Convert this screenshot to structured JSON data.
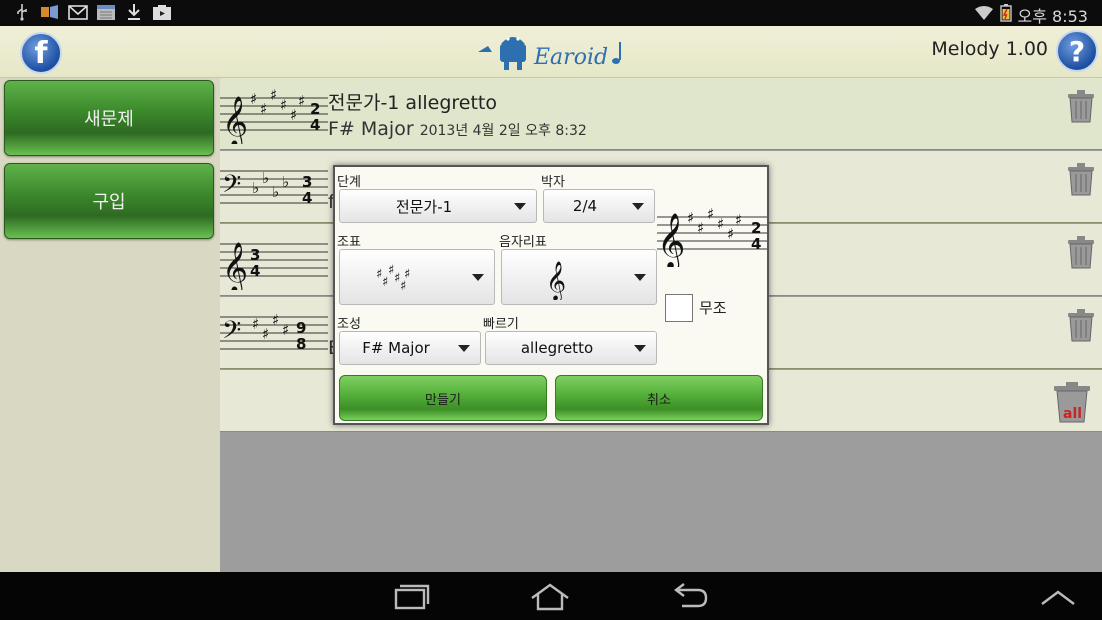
{
  "status_bar": {
    "left_icons": [
      "usb-icon",
      "media-icon",
      "gmail-icon",
      "calendar-icon",
      "download-icon",
      "video-icon"
    ],
    "right_icons": [
      "wifi-icon",
      "battery-icon"
    ],
    "time": "오후 8:53"
  },
  "header": {
    "facebook_glyph": "f",
    "app_logo": "Earoid",
    "version": "Melody 1.00",
    "help_glyph": "?"
  },
  "sidebar": {
    "items": [
      {
        "label": "새문제"
      },
      {
        "label": "구입"
      }
    ]
  },
  "list": {
    "items": [
      {
        "title": "전문가-1 allegretto",
        "key": "F# Major",
        "date": "2013년 4월 2일 오후 8:32",
        "clef": "treble",
        "time_sig": "2/4"
      },
      {
        "title": "",
        "key": "f",
        "date": "",
        "clef": "bass",
        "time_sig": "3/4"
      },
      {
        "title": "",
        "key": "",
        "date": "",
        "clef": "treble",
        "time_sig": "3/4"
      },
      {
        "title": "",
        "key": "E",
        "date": "",
        "clef": "bass",
        "time_sig": "9/8"
      }
    ]
  },
  "dialog": {
    "level_label": "단계",
    "level_value": "전문가-1",
    "time_label": "박자",
    "time_value": "2/4",
    "key_sig_label": "조표",
    "clef_label": "음자리표",
    "tonality_label": "조성",
    "tonality_value": "F# Major",
    "tempo_label": "빠르기",
    "tempo_value": "allegretto",
    "atonal_label": "무조",
    "atonal_checked": false,
    "create_label": "만들기",
    "cancel_label": "취소"
  },
  "colors": {
    "accent_green": "#4caa34",
    "header_bg": "#e6e6c8",
    "facebook_blue": "#1c4fa0"
  }
}
